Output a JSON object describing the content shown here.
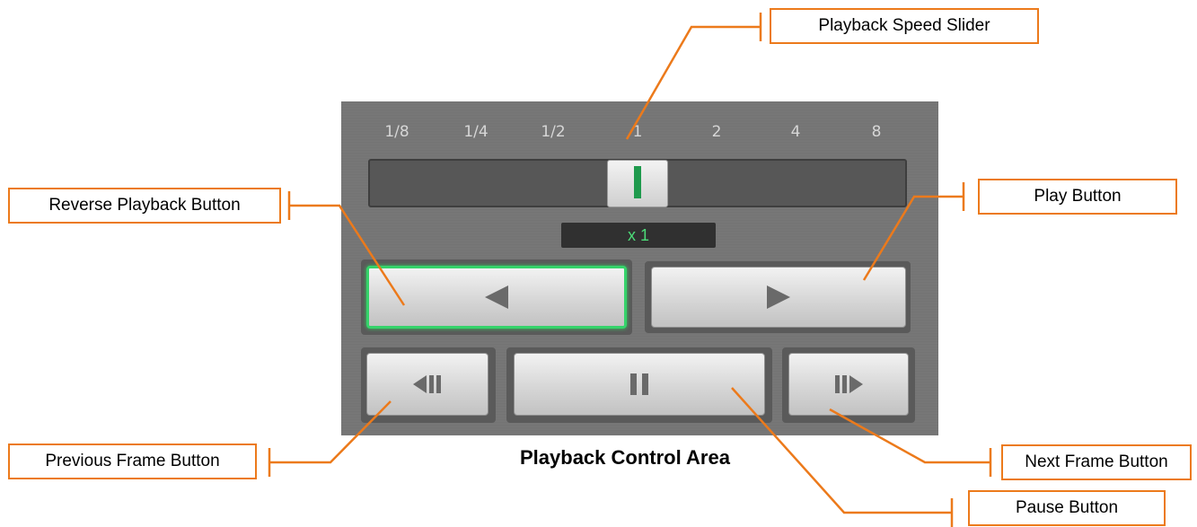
{
  "speed_slider": {
    "ticks": [
      "1/8",
      "1/4",
      "1/2",
      "1",
      "2",
      "4",
      "8"
    ],
    "current_value": "x 1"
  },
  "buttons": {
    "reverse_playback": {
      "icon": "reverse-play-icon",
      "active": true
    },
    "play": {
      "icon": "play-icon"
    },
    "previous_frame": {
      "icon": "previous-frame-icon"
    },
    "pause": {
      "icon": "pause-icon"
    },
    "next_frame": {
      "icon": "next-frame-icon"
    }
  },
  "caption": "Playback Control Area",
  "callouts": {
    "playback_speed_slider": "Playback Speed Slider",
    "reverse_playback_button": "Reverse Playback Button",
    "play_button": "Play Button",
    "previous_frame_button": "Previous Frame Button",
    "next_frame_button": "Next Frame Button",
    "pause_button": "Pause Button"
  },
  "colors": {
    "callout_orange": "#ec7a1b",
    "active_green": "#35d36a",
    "speed_text_green": "#4cdc78"
  }
}
